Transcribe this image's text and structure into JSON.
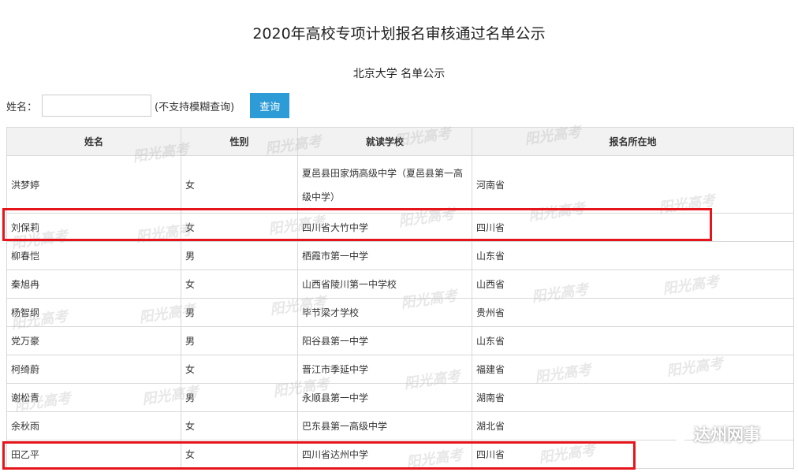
{
  "page": {
    "title": "2020年高校专项计划报名审核通过名单公示",
    "subtitle": "北京大学 名单公示"
  },
  "search": {
    "label": "姓名：",
    "value": "",
    "placeholder": "",
    "hint": "(不支持模糊查询)",
    "button_label": "查询"
  },
  "table": {
    "headers": [
      "姓名",
      "性别",
      "就读学校",
      "报名所在地"
    ],
    "rows": [
      {
        "name": "洪梦婷",
        "gender": "女",
        "school": "夏邑县田家炳高级中学（夏邑县第一高级中学）",
        "region": "河南省"
      },
      {
        "name": "刘保莉",
        "gender": "女",
        "school": "四川省大竹中学",
        "region": "四川省"
      },
      {
        "name": "柳春恺",
        "gender": "男",
        "school": "栖霞市第一中学",
        "region": "山东省"
      },
      {
        "name": "秦旭冉",
        "gender": "女",
        "school": "山西省陵川第一中学校",
        "region": "山西省"
      },
      {
        "name": "杨智纲",
        "gender": "男",
        "school": "毕节梁才学校",
        "region": "贵州省"
      },
      {
        "name": "党万豪",
        "gender": "男",
        "school": "阳谷县第一中学",
        "region": "山东省"
      },
      {
        "name": "柯绮蔚",
        "gender": "女",
        "school": "晋江市季延中学",
        "region": "福建省"
      },
      {
        "name": "谢松青",
        "gender": "男",
        "school": "永顺县第一中学",
        "region": "湖南省"
      },
      {
        "name": "余秋雨",
        "gender": "女",
        "school": "巴东县第一高级中学",
        "region": "湖北省"
      },
      {
        "name": "田乙平",
        "gender": "女",
        "school": "四川省达州中学",
        "region": "四川省"
      }
    ]
  },
  "watermark_text": "阳光高考",
  "brand": {
    "label": "达州网事",
    "icon": "wechat-bubble-icon"
  },
  "colors": {
    "button": "#2d9bd6",
    "highlight": "#e6141b",
    "header_bg": "#f2f2f2"
  }
}
